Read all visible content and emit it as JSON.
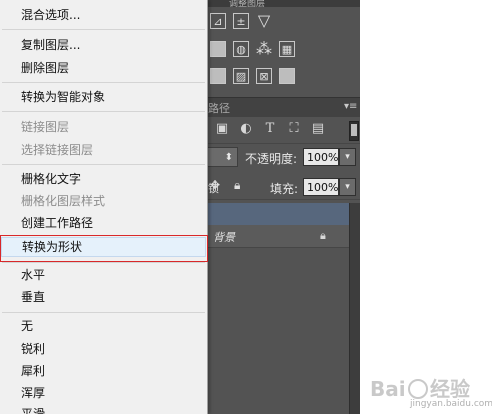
{
  "menu": {
    "items": [
      {
        "id": "blend-options",
        "label": "混合选项...",
        "enabled": true
      },
      {
        "id": "duplicate-layer",
        "label": "复制图层...",
        "enabled": true
      },
      {
        "id": "delete-layer",
        "label": "删除图层",
        "enabled": true
      },
      {
        "id": "convert-smart-object",
        "label": "转换为智能对象",
        "enabled": true
      },
      {
        "id": "link-layers",
        "label": "链接图层",
        "enabled": false
      },
      {
        "id": "select-linked-layers",
        "label": "选择链接图层",
        "enabled": false
      },
      {
        "id": "rasterize-type",
        "label": "栅格化文字",
        "enabled": true
      },
      {
        "id": "rasterize-layer-style",
        "label": "栅格化图层样式",
        "enabled": false
      },
      {
        "id": "create-work-path",
        "label": "创建工作路径",
        "enabled": true
      },
      {
        "id": "convert-to-shape",
        "label": "转换为形状",
        "enabled": true,
        "hovered": true
      },
      {
        "id": "horizontal",
        "label": "水平",
        "enabled": true
      },
      {
        "id": "vertical",
        "label": "垂直",
        "enabled": true
      },
      {
        "id": "aa-none",
        "label": "无",
        "enabled": true
      },
      {
        "id": "aa-sharp",
        "label": "锐利",
        "enabled": true
      },
      {
        "id": "aa-crisp",
        "label": "犀利",
        "enabled": true
      },
      {
        "id": "aa-strong",
        "label": "浑厚",
        "enabled": true
      },
      {
        "id": "aa-smooth",
        "label": "平滑",
        "enabled": true
      }
    ]
  },
  "panel": {
    "tab_label": "路径",
    "menu_icon": "▾≡",
    "opacity_label": "不透明度:",
    "opacity_value": "100%",
    "fill_label": "填充:",
    "fill_value": "100%",
    "lock_label": "锁",
    "layer_name": "背景",
    "top_text": "调整图层",
    "blend_arrow": "⬍",
    "dropdown_arrow": "▾"
  },
  "watermark": {
    "text": "jingyan.baidu.com"
  },
  "colors": {
    "highlight": "#d8282a",
    "selected_layer": "#57677d",
    "menu_bg": "#f0f0f0",
    "panel_bg": "#535353"
  }
}
